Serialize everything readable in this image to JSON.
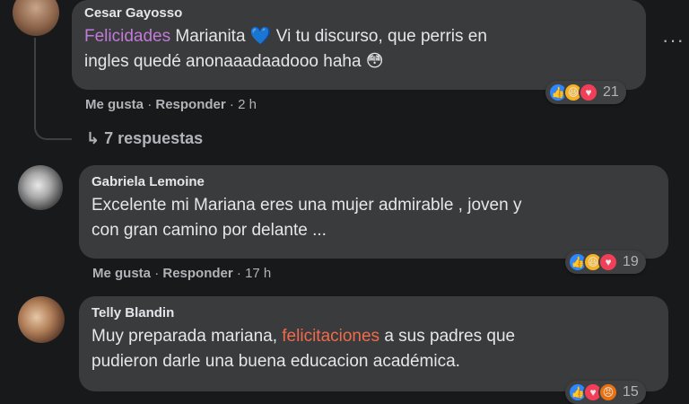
{
  "comments": [
    {
      "author": "Cesar Gayosso",
      "text_highlight": "Felicidades",
      "text_line1_rest": " Marianita 💙 Vi tu discurso, que perris en",
      "text_line2": "ingles quedé anonaaadaadooo haha 😳",
      "like_label": "Me gusta",
      "reply_label": "Responder",
      "time": "2 h",
      "reaction_count": "21",
      "replies_label": "7 respuestas"
    },
    {
      "author": "Gabriela Lemoine",
      "text_line1": "Excelente mi Mariana eres una mujer admirable , joven y",
      "text_line2": "con gran camino por delante ...",
      "like_label": "Me gusta",
      "reply_label": "Responder",
      "time": "17 h",
      "reaction_count": "19"
    },
    {
      "author": "Telly Blandin",
      "text_line1_pre": "Muy preparada mariana, ",
      "text_highlight": "felicitaciones",
      "text_line1_post": " a sus padres que",
      "text_line2": "pudieron darle una buena educacion académica.",
      "reaction_count": "15"
    }
  ],
  "more_label": "···"
}
